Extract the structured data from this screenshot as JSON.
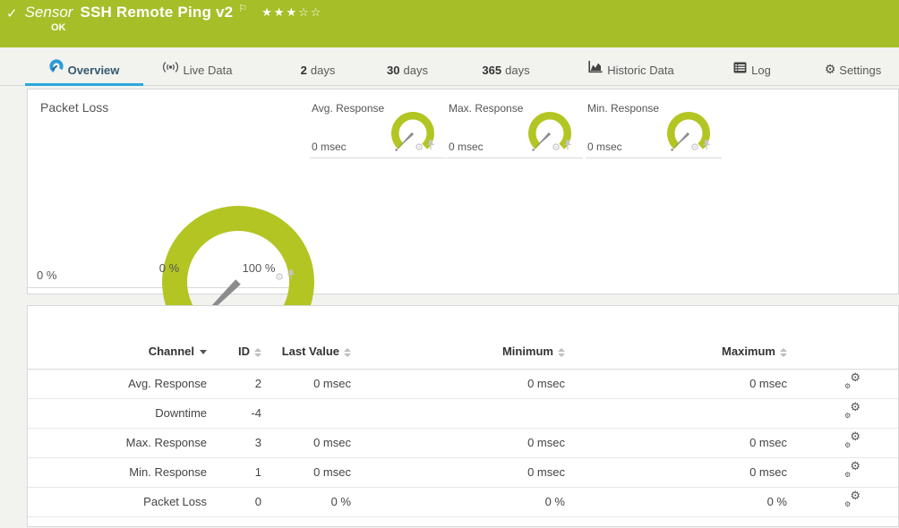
{
  "header": {
    "kind_label": "Sensor",
    "title": "SSH Remote Ping v2",
    "status": "OK",
    "rating_stars": "★★★☆☆",
    "bar_color": "#a6be28"
  },
  "tabs": {
    "overview": {
      "label": "Overview"
    },
    "live_data": {
      "label": "Live Data"
    },
    "days2": {
      "prefix": "2",
      "label": "days"
    },
    "days30": {
      "prefix": "30",
      "label": "days"
    },
    "days365": {
      "prefix": "365",
      "label": "days"
    },
    "historic": {
      "label": "Historic Data"
    },
    "log": {
      "label": "Log"
    },
    "settings": {
      "label": "Settings"
    },
    "accent_color": "#2aa7dc"
  },
  "gauges": {
    "color": "#b2c522",
    "needle_color": "#8c8c8c",
    "primary": {
      "title": "Packet Loss",
      "value": "0 %",
      "scale_min": "0 %",
      "scale_max": "100 %"
    },
    "avg": {
      "title": "Avg. Response",
      "value": "0 msec"
    },
    "max": {
      "title": "Max. Response",
      "value": "0 msec"
    },
    "min": {
      "title": "Min. Response",
      "value": "0 msec"
    }
  },
  "channel_table": {
    "columns": {
      "channel": "Channel",
      "id": "ID",
      "last": "Last Value",
      "min": "Minimum",
      "max": "Maximum"
    },
    "sorted_by": "Channel",
    "rows": [
      {
        "channel": "Avg. Response",
        "id": "2",
        "last": "0 msec",
        "min": "0 msec",
        "max": "0 msec"
      },
      {
        "channel": "Downtime",
        "id": "-4",
        "last": "",
        "min": "",
        "max": ""
      },
      {
        "channel": "Max. Response",
        "id": "3",
        "last": "0 msec",
        "min": "0 msec",
        "max": "0 msec"
      },
      {
        "channel": "Min. Response",
        "id": "1",
        "last": "0 msec",
        "min": "0 msec",
        "max": "0 msec"
      },
      {
        "channel": "Packet Loss",
        "id": "0",
        "last": "0 %",
        "min": "0 %",
        "max": "0 %"
      }
    ]
  }
}
